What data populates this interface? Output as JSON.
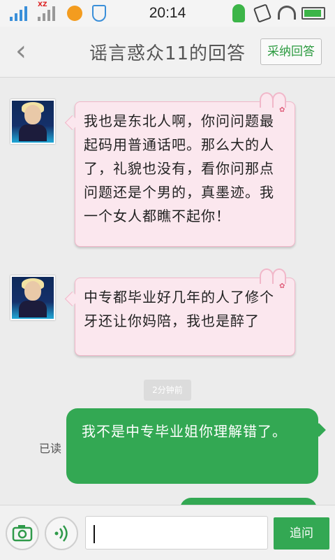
{
  "status_bar": {
    "carrier_tag": "XZ",
    "time": "20:14"
  },
  "header": {
    "back_icon": "chevron-left-icon",
    "title": "谣言惑众11的回答",
    "adopt_label": "采纳回答"
  },
  "messages": [
    {
      "side": "left",
      "text": "我也是东北人啊，你问问题最起码用普通话吧。那么大的人了，礼貌也没有，看你问那点问题还是个男的，真墨迹。我一个女人都瞧不起你！"
    },
    {
      "side": "left",
      "text": "中专都毕业好几年的人了修个牙还让你妈陪，我也是醉了"
    }
  ],
  "timestamp": "2分钟前",
  "my_message": {
    "read_status": "已读",
    "text": "我不是中专毕业姐你理解错了。"
  },
  "input_bar": {
    "camera_icon": "camera-icon",
    "voice_icon": "voice-icon",
    "input_value": "",
    "ask_label": "追问"
  },
  "colors": {
    "accent_green": "#33a853",
    "bubble_pink": "#fbe7ee"
  }
}
